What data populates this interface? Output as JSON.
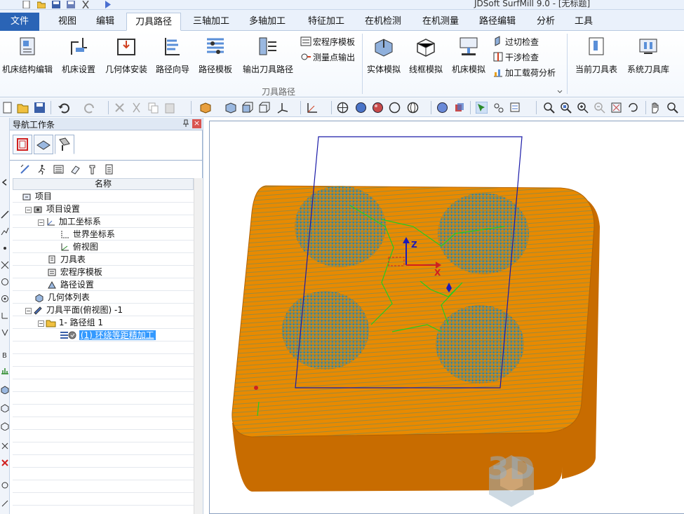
{
  "app": {
    "title": "JDSoft SurfMill 9.0 - [无标题]"
  },
  "menu": {
    "file": "文件",
    "tabs": [
      "视图",
      "编辑",
      "刀具路径",
      "三轴加工",
      "多轴加工",
      "特征加工",
      "在机检测",
      "在机测量",
      "路径编辑",
      "分析",
      "工具"
    ],
    "active_tab": "刀具路径"
  },
  "ribbon": {
    "big_buttons": [
      "机床结构编辑",
      "机床设置",
      "几何体安装",
      "路径向导",
      "路径模板",
      "输出刀具路径",
      "实体模拟",
      "线框模拟",
      "机床模拟",
      "当前刀具表",
      "系统刀具库"
    ],
    "small_buttons": [
      "宏程序模板",
      "测量点输出",
      "过切检查",
      "干涉检查",
      "加工载荷分析"
    ],
    "group_label": "刀具路径"
  },
  "nav": {
    "title": "导航工作条",
    "pin": "ᵖ",
    "close": "×",
    "column_header": "名称",
    "tree": [
      {
        "label": "项目",
        "level": 0,
        "icon": "project-icon",
        "expand": ""
      },
      {
        "label": "项目设置",
        "level": 1,
        "icon": "settings-icon",
        "expand": "−"
      },
      {
        "label": "加工坐标系",
        "level": 2,
        "icon": "coord-system-icon",
        "expand": "−"
      },
      {
        "label": "世界坐标系",
        "level": 3,
        "icon": "world-coord-icon",
        "expand": ""
      },
      {
        "label": "俯视图",
        "level": 3,
        "icon": "top-view-icon",
        "expand": ""
      },
      {
        "label": "刀具表",
        "level": 2,
        "icon": "tool-table-icon",
        "expand": ""
      },
      {
        "label": "宏程序模板",
        "level": 2,
        "icon": "macro-template-icon",
        "expand": ""
      },
      {
        "label": "路径设置",
        "level": 2,
        "icon": "path-settings-icon",
        "expand": ""
      },
      {
        "label": "几何体列表",
        "level": 1,
        "icon": "geometry-list-icon",
        "expand": ""
      },
      {
        "label": "刀具平面(俯视图) -1",
        "level": 1,
        "icon": "tool-plane-icon",
        "expand": "−"
      },
      {
        "label": "1- 路径组 1",
        "level": 2,
        "icon": "folder-icon",
        "expand": "−"
      },
      {
        "label": "(1) 环绕等距精加工",
        "level": 3,
        "icon": "toolpath-icon",
        "expand": "",
        "selected": true
      }
    ]
  },
  "viewport": {
    "axis_z": "Z",
    "axis_x": "X",
    "watermark": "3D"
  },
  "colors": {
    "part": "#e88a00",
    "part_dark": "#c86c00",
    "bounding_box": "#1a1aa8",
    "toolpath_link": "#22cc22",
    "selection": "#3399ff",
    "file_tab": "#2a64b6"
  }
}
